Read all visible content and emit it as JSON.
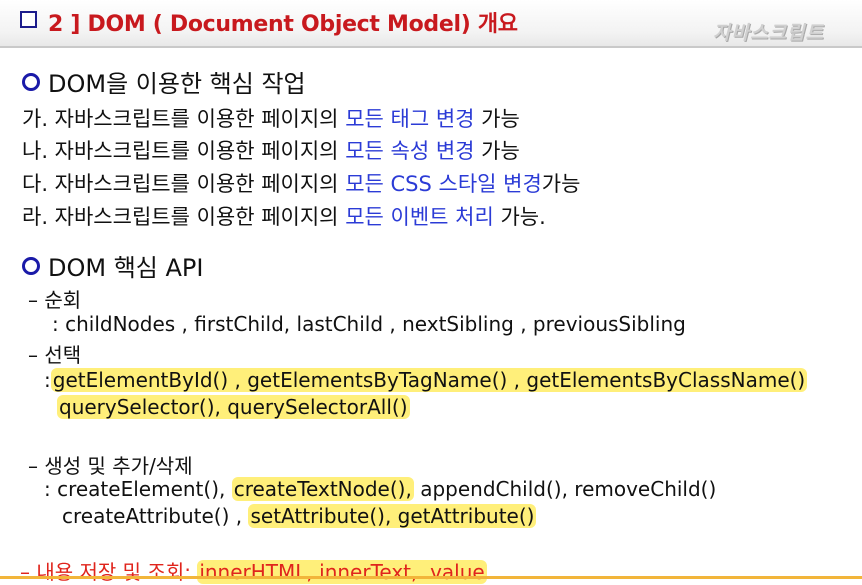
{
  "header": {
    "title": "2 ] DOM ( Document Object Model) 개요",
    "brand": "자바스크립트"
  },
  "section1": {
    "title": "DOM을 이용한 핵심 작업",
    "items": [
      {
        "prefix": "가. 자바스크립트를 이용한 페이지의 ",
        "highlight": "모든 태그 변경",
        "suffix": " 가능"
      },
      {
        "prefix": "나. 자바스크립트를 이용한 페이지의 ",
        "highlight": "모든 속성 변경",
        "suffix": " 가능"
      },
      {
        "prefix": "다. 자바스크립트를 이용한 페이지의 ",
        "highlight": "모든 CSS 스타일 변경",
        "suffix": "가능"
      },
      {
        "prefix": "라. 자바스크립트를 이용한 페이지의 ",
        "highlight": "모든 이벤트 처리",
        "suffix": " 가능."
      }
    ]
  },
  "section2": {
    "title": "DOM 핵심 API",
    "traverse": {
      "label": "–  순회",
      "content": ": childNodes , firstChild, lastChild , nextSibling , previousSibling"
    },
    "select": {
      "label": "–  선택",
      "colon": ":",
      "line1": "getElementById() , getElementsByTagName() , getElementsByClassName()",
      "line2": "querySelector(), querySelectorAll()"
    },
    "create": {
      "label": "–  생성 및 추가/삭제",
      "line1_a": ": createElement(),",
      "line1_b": "createTextNode(),",
      "line1_c": "appendChild(),  removeChild()",
      "line2_a": "createAttribute() ,",
      "line2_b": "setAttribute(), getAttribute()"
    },
    "content": {
      "label": "–  내용 저장 및 조회:",
      "value": "innerHTML, innerText, .value"
    }
  }
}
